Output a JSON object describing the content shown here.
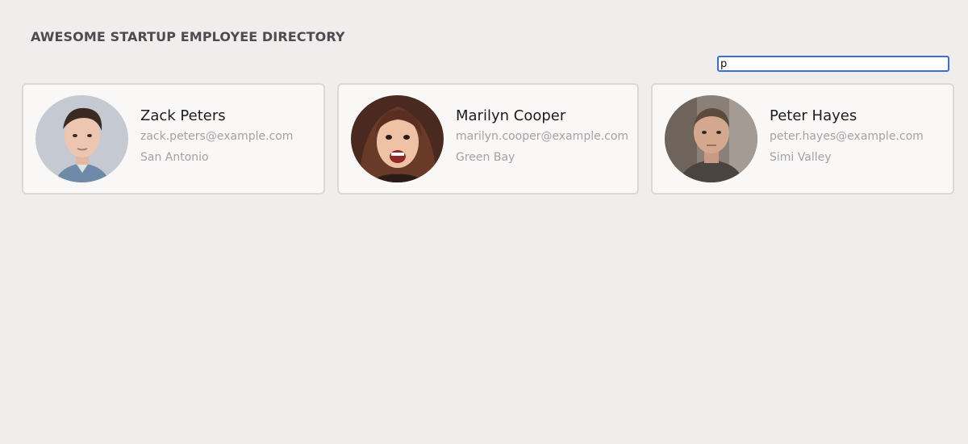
{
  "header": {
    "title": "AWESOME STARTUP EMPLOYEE DIRECTORY"
  },
  "search": {
    "value": "p",
    "placeholder": ""
  },
  "employees": [
    {
      "name": "Zack Peters",
      "email": "zack.peters@example.com",
      "city": "San Antonio"
    },
    {
      "name": "Marilyn Cooper",
      "email": "marilyn.cooper@example.com",
      "city": "Green Bay"
    },
    {
      "name": "Peter Hayes",
      "email": "peter.hayes@example.com",
      "city": "Simi Valley"
    }
  ],
  "colors": {
    "background": "#efeeec",
    "card": "#f9f8f6",
    "card_border": "#dad9d7",
    "search_border": "#3f6ed1",
    "name_text": "#1c1c1f",
    "secondary_text": "#a3a2a4"
  }
}
